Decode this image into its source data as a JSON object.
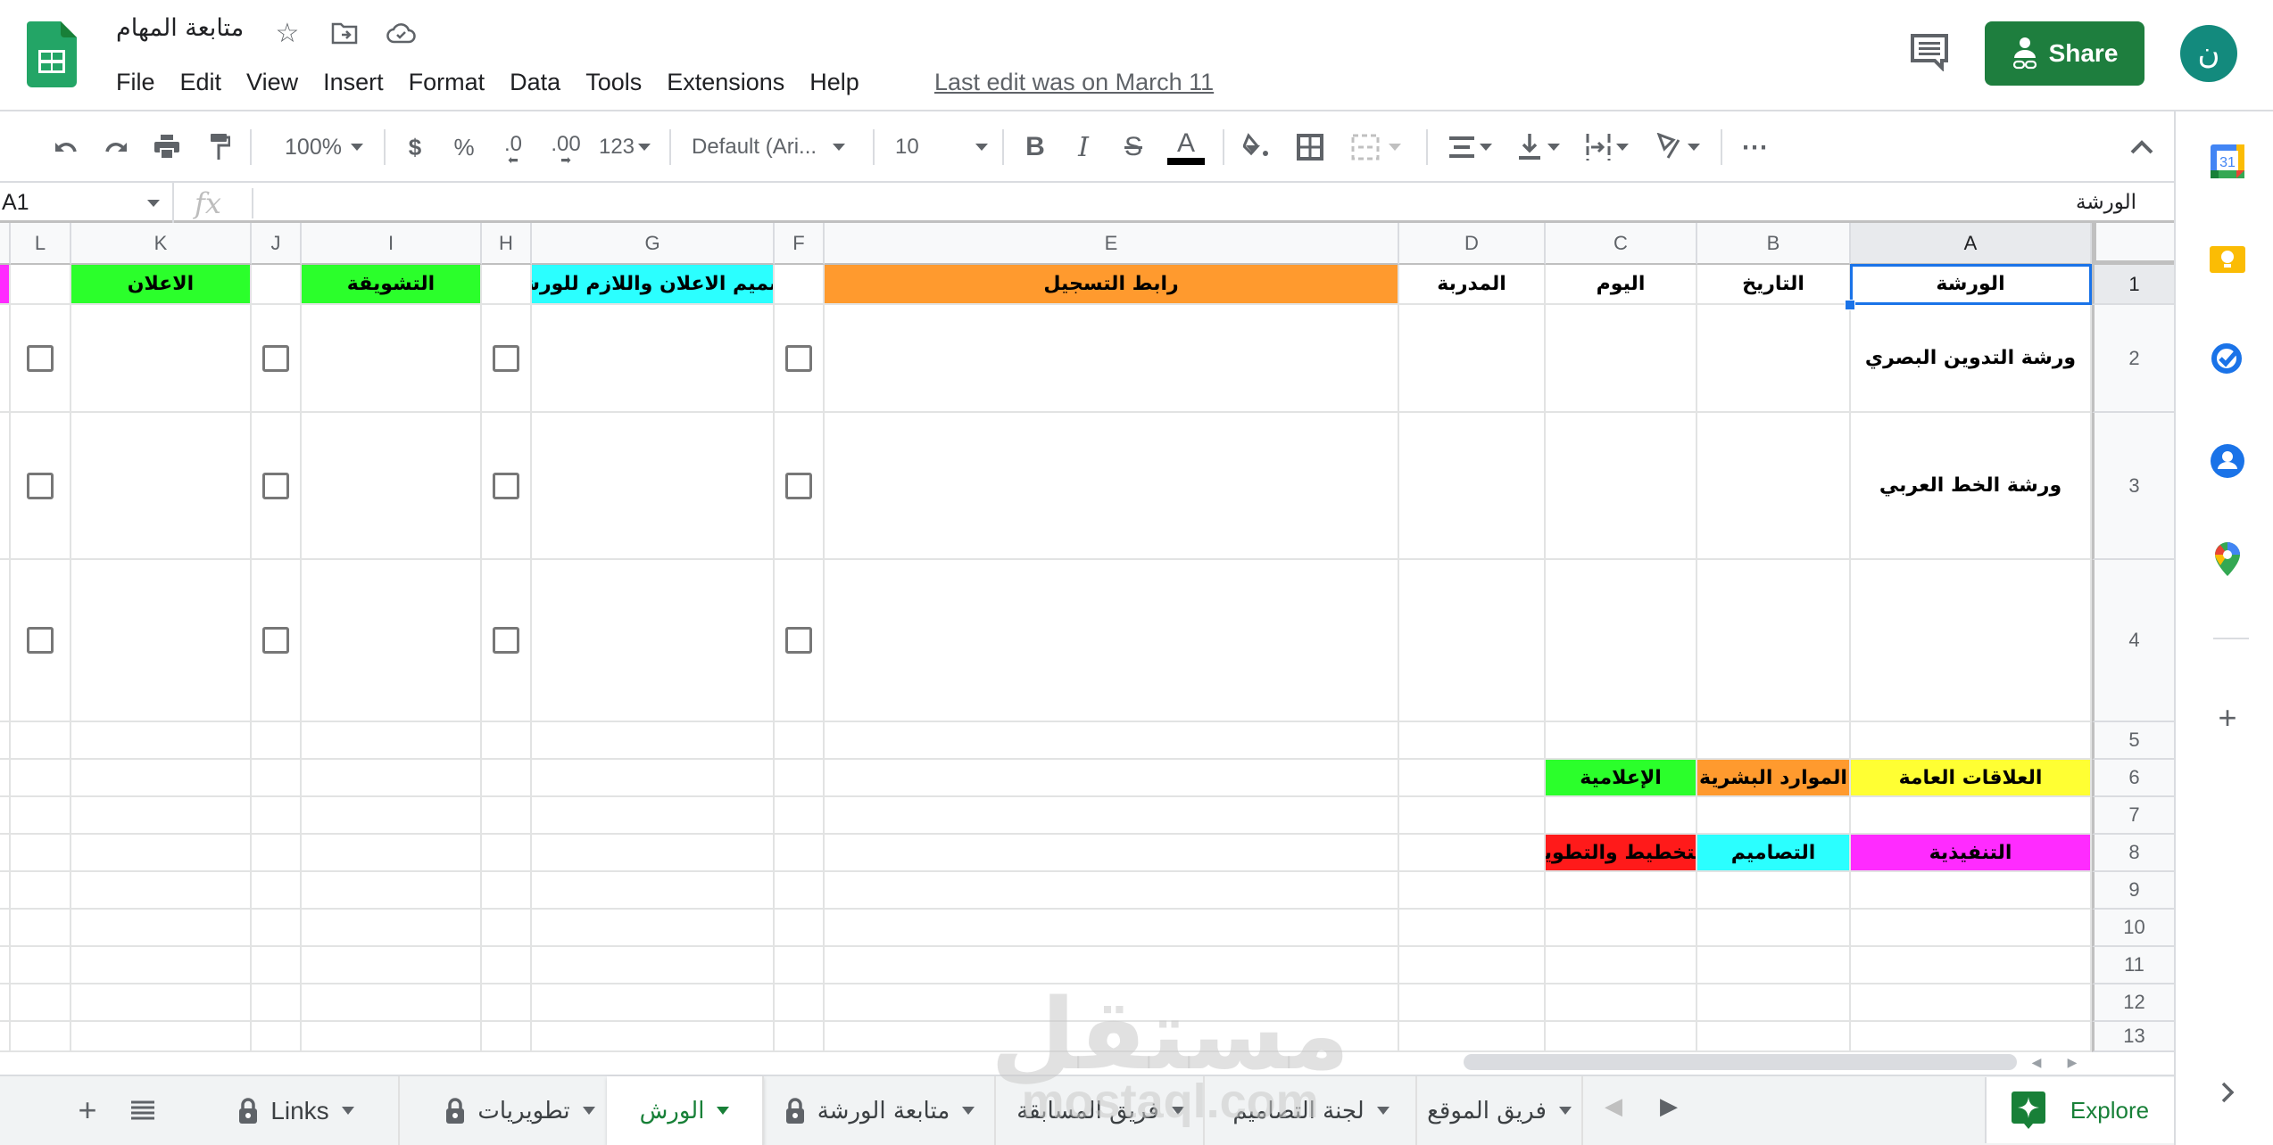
{
  "app": {
    "doc_title": "متابعة المهام",
    "last_edit": "Last edit was on March 11",
    "share_label": "Share",
    "avatar_initial": "ن"
  },
  "menu": [
    "File",
    "Edit",
    "View",
    "Insert",
    "Format",
    "Data",
    "Tools",
    "Extensions",
    "Help"
  ],
  "toolbar": {
    "zoom": "100%",
    "currency": "$",
    "percent": "%",
    "decrease_decimals": ".0",
    "increase_decimals": ".00",
    "number_format": "123",
    "font": "Default (Ari...",
    "font_size": "10",
    "bold": "B",
    "italic": "I",
    "strikethrough": "S",
    "text_color": "A",
    "text_color_value": "#000000",
    "more": "⋯"
  },
  "formula_bar": {
    "cell_ref": "A1",
    "fx": "fx",
    "value": "الورشة"
  },
  "grid": {
    "columns": [
      "A",
      "B",
      "C",
      "D",
      "E",
      "F",
      "G",
      "H",
      "I",
      "J",
      "K",
      "L"
    ],
    "selected_column": "A",
    "rows": [
      "1",
      "2",
      "3",
      "4",
      "5",
      "6",
      "7",
      "8",
      "9",
      "10",
      "11",
      "12",
      "13"
    ],
    "selected_row": "1",
    "header_row": {
      "A": "الورشة",
      "B": "التاريخ",
      "C": "اليوم",
      "D": "المدربة",
      "E": "رابط التسجيل",
      "G": "تصميم الاعلان واللازم للورشة",
      "I": "التشويقة",
      "K": "الاعلان"
    },
    "workshops": [
      {
        "row": "2",
        "name": "ورشة التدوين البصري",
        "checks": {
          "F": false,
          "H": false,
          "J": false,
          "L": false
        }
      },
      {
        "row": "3",
        "name": "ورشة الخط العربي",
        "checks": {
          "F": false,
          "H": false,
          "J": false,
          "L": false
        }
      },
      {
        "row": "4",
        "name": "",
        "checks": {
          "F": false,
          "H": false,
          "J": false,
          "L": false
        }
      }
    ],
    "legend_row_6": [
      {
        "col": "A",
        "label": "العلاقات العامة",
        "color": "#ffff33"
      },
      {
        "col": "B",
        "label": "الموارد البشرية",
        "color": "#ff9a2e"
      },
      {
        "col": "C",
        "label": "الإعلامية",
        "color": "#2bff2b"
      }
    ],
    "legend_row_8": [
      {
        "col": "A",
        "label": "التنفيذية",
        "color": "#ff2bff"
      },
      {
        "col": "B",
        "label": "التصاميم",
        "color": "#2bffff"
      },
      {
        "col": "C",
        "label": "التخطيط والتطوير",
        "color": "#ff1a1a"
      }
    ],
    "header_colors": {
      "E": "#ff9a2e",
      "G": "#2bffff",
      "I": "#2bff2b",
      "K": "#2bff2b",
      "left_strip": "#ff2bff"
    }
  },
  "sheet_tabs": [
    {
      "label": "Links",
      "locked": true,
      "active": false
    },
    {
      "label": "تطويريات",
      "locked": true,
      "active": false
    },
    {
      "label": "الورش",
      "locked": false,
      "active": true
    },
    {
      "label": "متابعة الورشة",
      "locked": true,
      "active": false
    },
    {
      "label": "فريق المسابقة",
      "locked": false,
      "active": false
    },
    {
      "label": "لجنة التصاميم",
      "locked": false,
      "active": false
    },
    {
      "label": "فريق الموقع",
      "locked": false,
      "active": false
    }
  ],
  "explore_label": "Explore",
  "side_panel": {
    "calendar_day": "31",
    "apps": [
      "calendar-icon",
      "keep-icon",
      "tasks-icon",
      "contacts-icon",
      "maps-icon"
    ]
  },
  "watermark": {
    "arabic": "مستقل",
    "latin": "mostaql.com"
  },
  "colors": {
    "share_green": "#1e7e3e",
    "avatar_teal": "#138a7d",
    "selection_blue": "#1a73e8",
    "active_tab_green": "#188038"
  }
}
